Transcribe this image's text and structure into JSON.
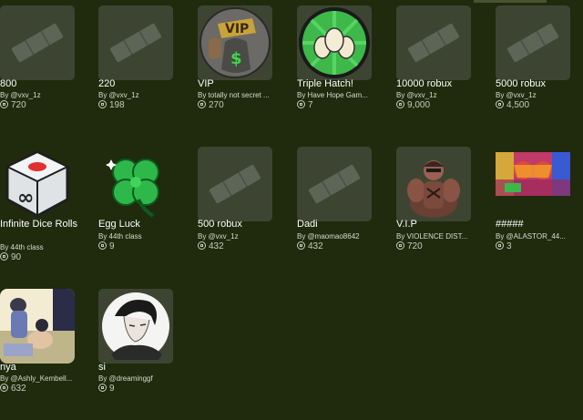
{
  "row1": [
    {
      "name": "800",
      "creator": "By @vxv_1z",
      "price": "720",
      "thumb": "ticket-icon"
    },
    {
      "name": "220",
      "creator": "By @vxv_1z",
      "price": "198",
      "thumb": "ticket-icon"
    },
    {
      "name": "VIP",
      "creator": "By totally not secret ...",
      "price": "270",
      "thumb": "vip-money-bag-icon"
    },
    {
      "name": "Triple Hatch!",
      "creator": "By Have Hope Gam...",
      "price": "7",
      "thumb": "three-eggs-icon"
    },
    {
      "name": "10000 robux",
      "creator": "By @vxv_1z",
      "price": "9,000",
      "thumb": "ticket-icon"
    },
    {
      "name": "5000 robux",
      "creator": "By @vxv_1z",
      "price": "4,500",
      "thumb": "ticket-icon"
    }
  ],
  "row2": [
    {
      "name": "Infinite Dice Rolls",
      "creator": "By 44th class",
      "price": "90",
      "thumb": "infinity-dice-icon"
    },
    {
      "name": "Egg Luck",
      "creator": "By 44th class",
      "price": "9",
      "thumb": "four-leaf-clover-icon"
    },
    {
      "name": "500 robux",
      "creator": "By @vxv_1z",
      "price": "432",
      "thumb": "ticket-icon"
    },
    {
      "name": "Dadi",
      "creator": "By @maomao8642",
      "price": "432",
      "thumb": "ticket-icon"
    },
    {
      "name": "V.I.P",
      "creator": "By VIOLENCE DIST...",
      "price": "720",
      "thumb": "muscular-character-icon"
    },
    {
      "name": "#####",
      "creator": "By @ALASTOR_44...",
      "price": "3",
      "thumb": "colorful-art-icon"
    }
  ],
  "row3": [
    {
      "name": "nya",
      "creator": "By @Ashly_Kembell...",
      "price": "632",
      "thumb": "anime-character-icon"
    },
    {
      "name": "si",
      "creator": "By @dreaminggf",
      "price": "9",
      "thumb": "portrait-sketch-icon"
    }
  ]
}
